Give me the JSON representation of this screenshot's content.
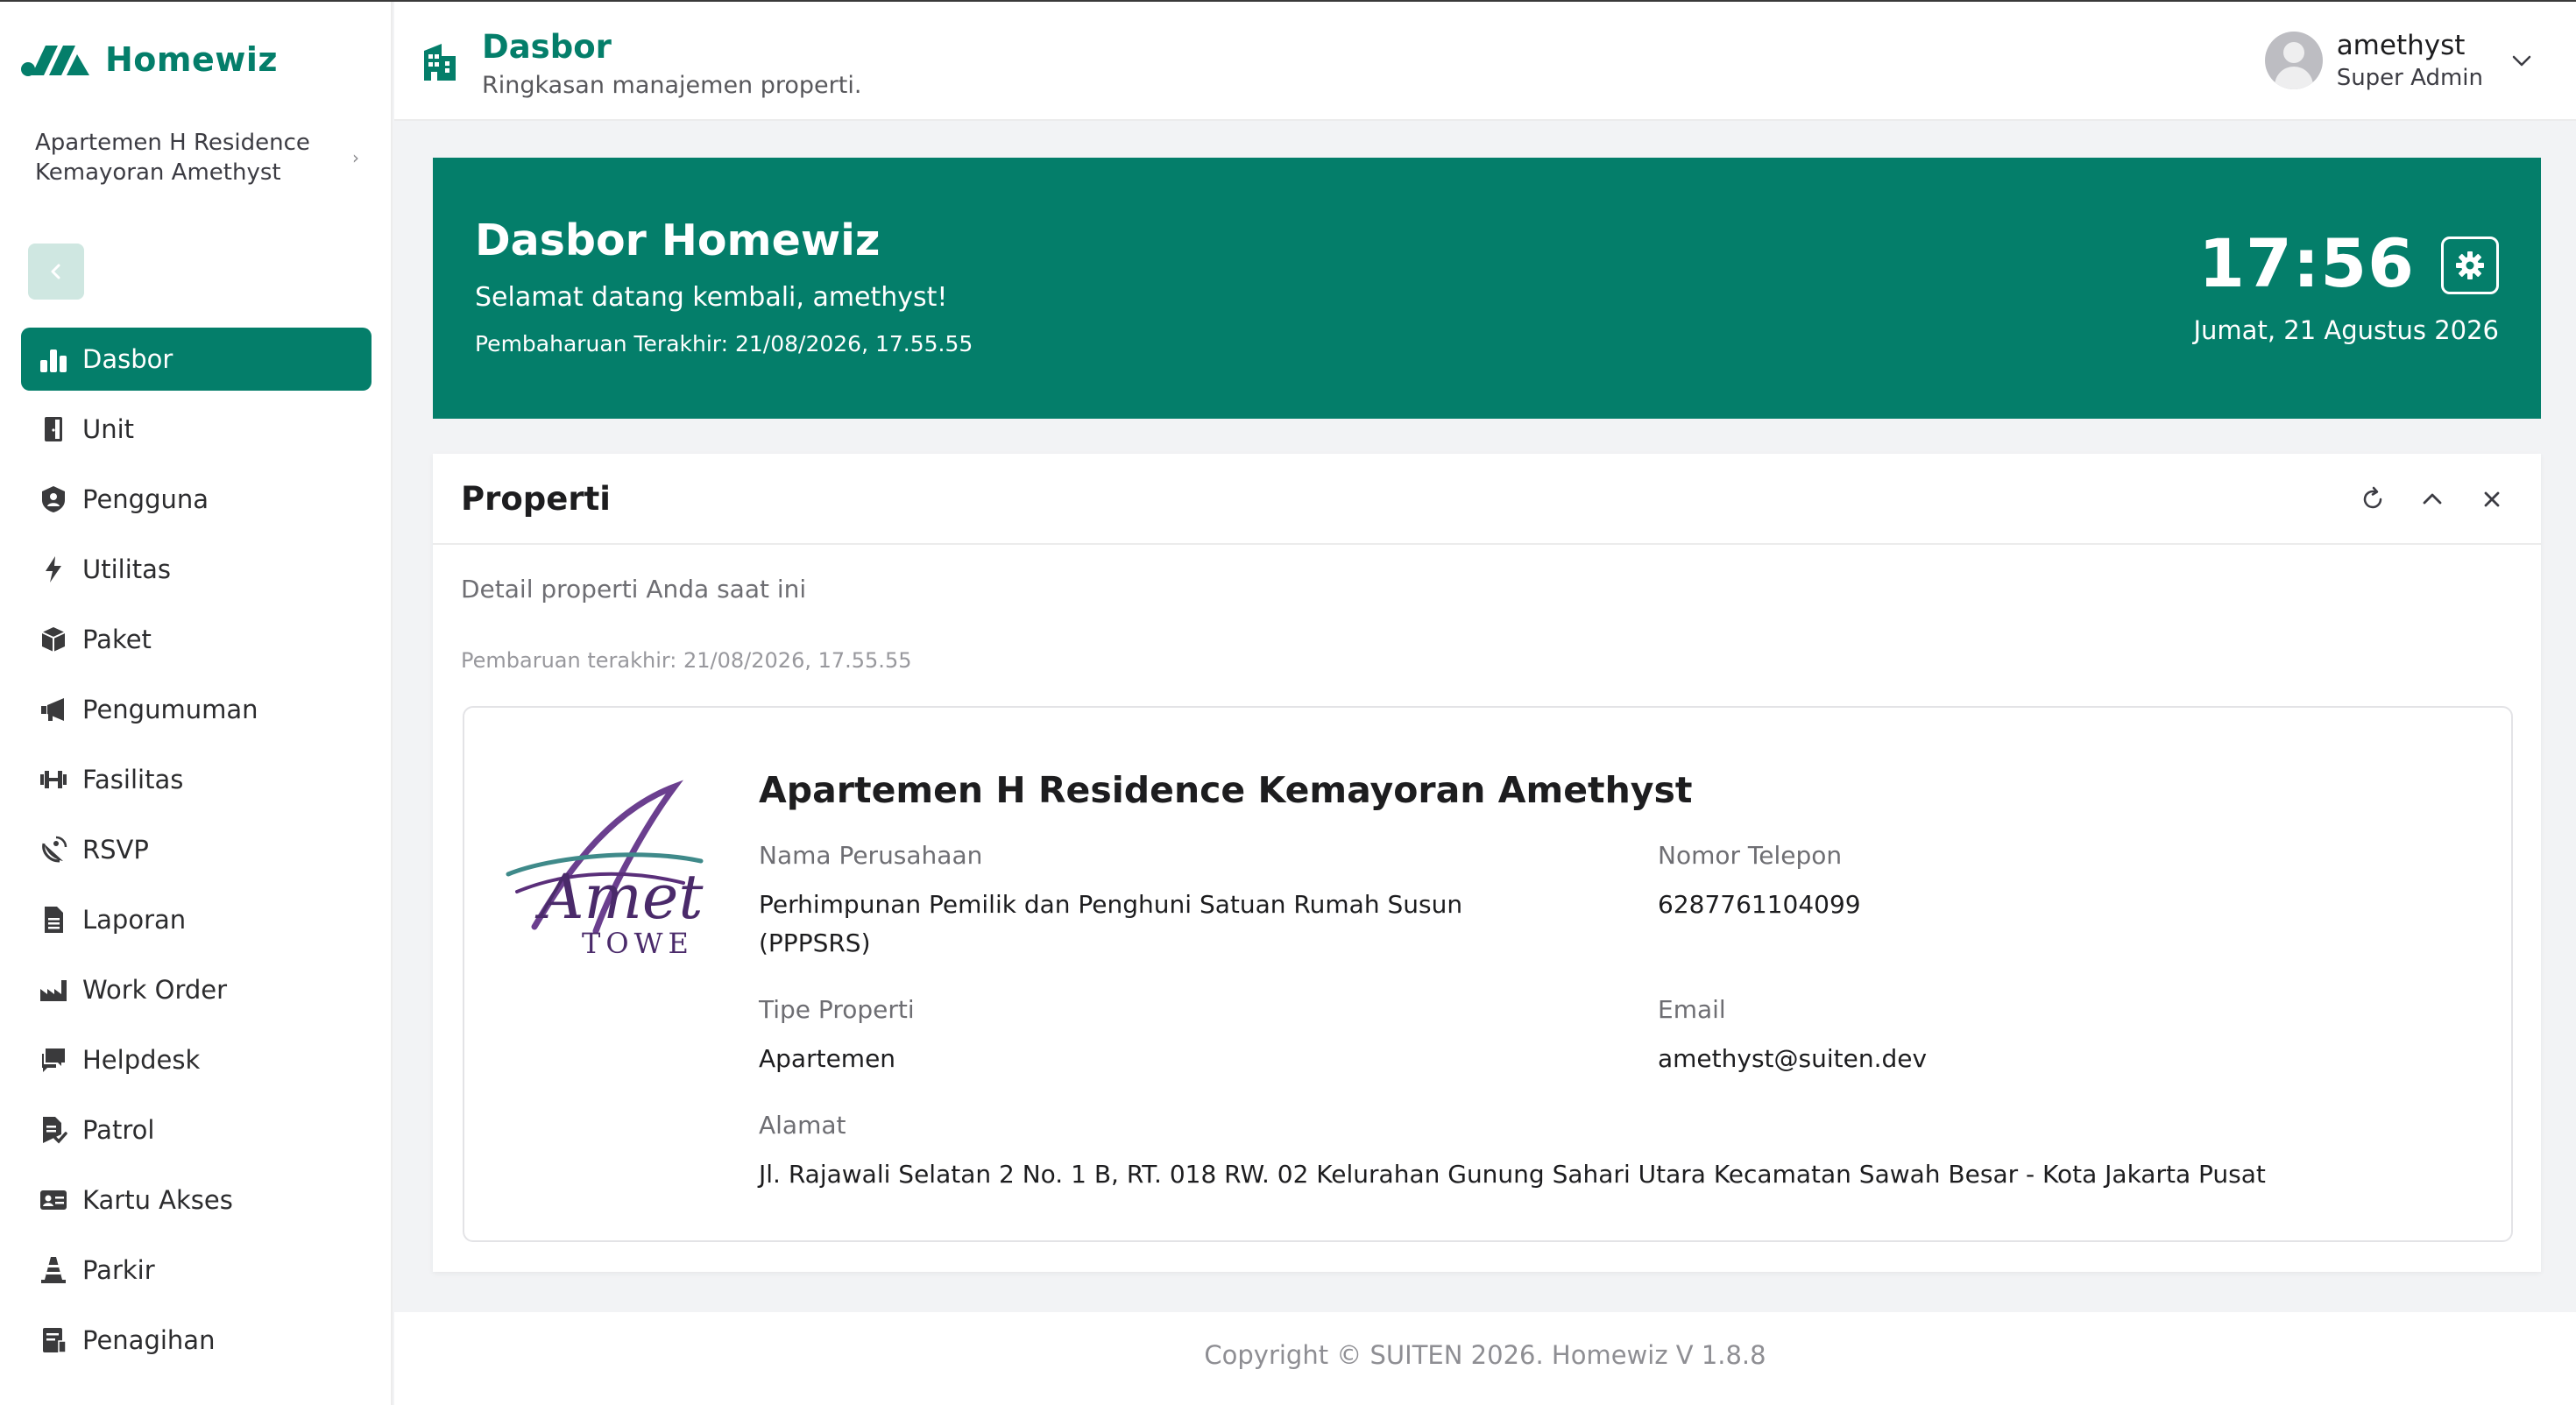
{
  "app": {
    "brand_name": "Homewiz",
    "brand_color": "#047e6a"
  },
  "sidebar": {
    "property_selector": {
      "name": "Apartemen H Residence Kemayoran Amethyst",
      "chevron_icon": "chevron-right-icon"
    },
    "collapse_icon": "chevron-left-icon",
    "items": [
      {
        "label": "Dasbor",
        "icon": "bar-chart-icon",
        "active": true
      },
      {
        "label": "Unit",
        "icon": "door-icon",
        "active": false
      },
      {
        "label": "Pengguna",
        "icon": "user-lock-icon",
        "active": false
      },
      {
        "label": "Utilitas",
        "icon": "bolt-icon",
        "active": false
      },
      {
        "label": "Paket",
        "icon": "package-icon",
        "active": false
      },
      {
        "label": "Pengumuman",
        "icon": "megaphone-icon",
        "active": false
      },
      {
        "label": "Fasilitas",
        "icon": "dumbbell-icon",
        "active": false
      },
      {
        "label": "RSVP",
        "icon": "satellite-dish-icon",
        "active": false
      },
      {
        "label": "Laporan",
        "icon": "document-icon",
        "active": false
      },
      {
        "label": "Work Order",
        "icon": "industry-icon",
        "active": false
      },
      {
        "label": "Helpdesk",
        "icon": "chat-icon",
        "active": false
      },
      {
        "label": "Patrol",
        "icon": "file-check-icon",
        "active": false
      },
      {
        "label": "Kartu Akses",
        "icon": "id-card-icon",
        "active": false
      },
      {
        "label": "Parkir",
        "icon": "traffic-cone-icon",
        "active": false
      },
      {
        "label": "Penagihan",
        "icon": "invoice-icon",
        "active": false
      }
    ]
  },
  "header": {
    "icon": "building-icon",
    "title": "Dasbor",
    "subtitle": "Ringkasan manajemen properti."
  },
  "user": {
    "name": "amethyst",
    "role": "Super Admin",
    "avatar_icon": "avatar-icon",
    "menu_icon": "chevron-down-icon"
  },
  "banner": {
    "title": "Dasbor Homewiz",
    "welcome": "Selamat datang kembali, amethyst!",
    "last_updated": "Pembaharuan Terakhir: 21/08/2026, 17.55.55",
    "time": "17:56",
    "date": "Jumat, 21 Agustus 2026",
    "settings_icon": "gear-icon"
  },
  "property_card": {
    "title": "Properti",
    "description": "Detail properti Anda saat ini",
    "last_updated": "Pembaruan terakhir: 21/08/2026, 17.55.55",
    "tools": {
      "refresh_icon": "refresh-icon",
      "collapse_icon": "chevron-up-icon",
      "close_icon": "close-icon"
    },
    "property": {
      "name": "Apartemen H Residence Kemayoran Amethyst",
      "logo_text": "Amet",
      "logo_subtext": "TOWE",
      "fields": {
        "company_label": "Nama Perusahaan",
        "company_value": "Perhimpunan Pemilik dan Penghuni Satuan Rumah Susun (PPPSRS)",
        "phone_label": "Nomor Telepon",
        "phone_value": "6287761104099",
        "type_label": "Tipe Properti",
        "type_value": "Apartemen",
        "email_label": "Email",
        "email_value": "amethyst@suiten.dev",
        "address_label": "Alamat",
        "address_value": "Jl. Rajawali Selatan 2 No. 1 B, RT. 018 RW. 02 Kelurahan Gunung Sahari Utara Kecamatan Sawah Besar - Kota Jakarta Pusat"
      }
    }
  },
  "footer": {
    "text": "Copyright © SUITEN 2026. Homewiz V 1.8.8"
  }
}
